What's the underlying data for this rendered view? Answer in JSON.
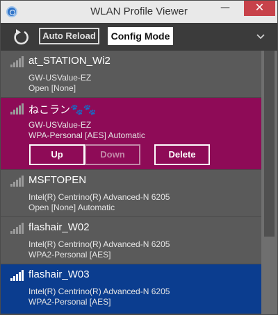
{
  "window": {
    "title": "WLAN Profile Viewer",
    "minimize_glyph": "—",
    "maximize_glyph": "☐",
    "close_glyph": "✕"
  },
  "toolbar": {
    "auto_reload_label": "Auto Reload",
    "config_mode_label": "Config Mode"
  },
  "profiles": [
    {
      "name": "at_STATION_Wi2",
      "interface": "GW-USValue-EZ",
      "security": "Open [None]",
      "state": "normal"
    },
    {
      "name": "ねこラン🐾🐾",
      "interface": "GW-USValue-EZ",
      "security": "WPA-Personal [AES] Automatic",
      "state": "selected",
      "actions": {
        "up": "Up",
        "down": "Down",
        "delete": "Delete"
      }
    },
    {
      "name": "MSFTOPEN",
      "interface": "Intel(R) Centrino(R) Advanced-N 6205",
      "security": "Open [None] Automatic",
      "state": "normal"
    },
    {
      "name": "flashair_W02",
      "interface": "Intel(R) Centrino(R) Advanced-N 6205",
      "security": "WPA2-Personal [AES]",
      "state": "normal"
    },
    {
      "name": "flashair_W03",
      "interface": "Intel(R) Centrino(R) Advanced-N 6205",
      "security": "WPA2-Personal [AES]",
      "state": "connected"
    }
  ],
  "colors": {
    "selected_item": "#8e0b57",
    "connected_item": "#0b3d8f",
    "close_button": "#c7424a"
  },
  "icons": {
    "app": "wifi-app-icon",
    "reload": "reload-icon",
    "expand": "chevron-down-icon",
    "signal": "signal-bars-icon"
  }
}
